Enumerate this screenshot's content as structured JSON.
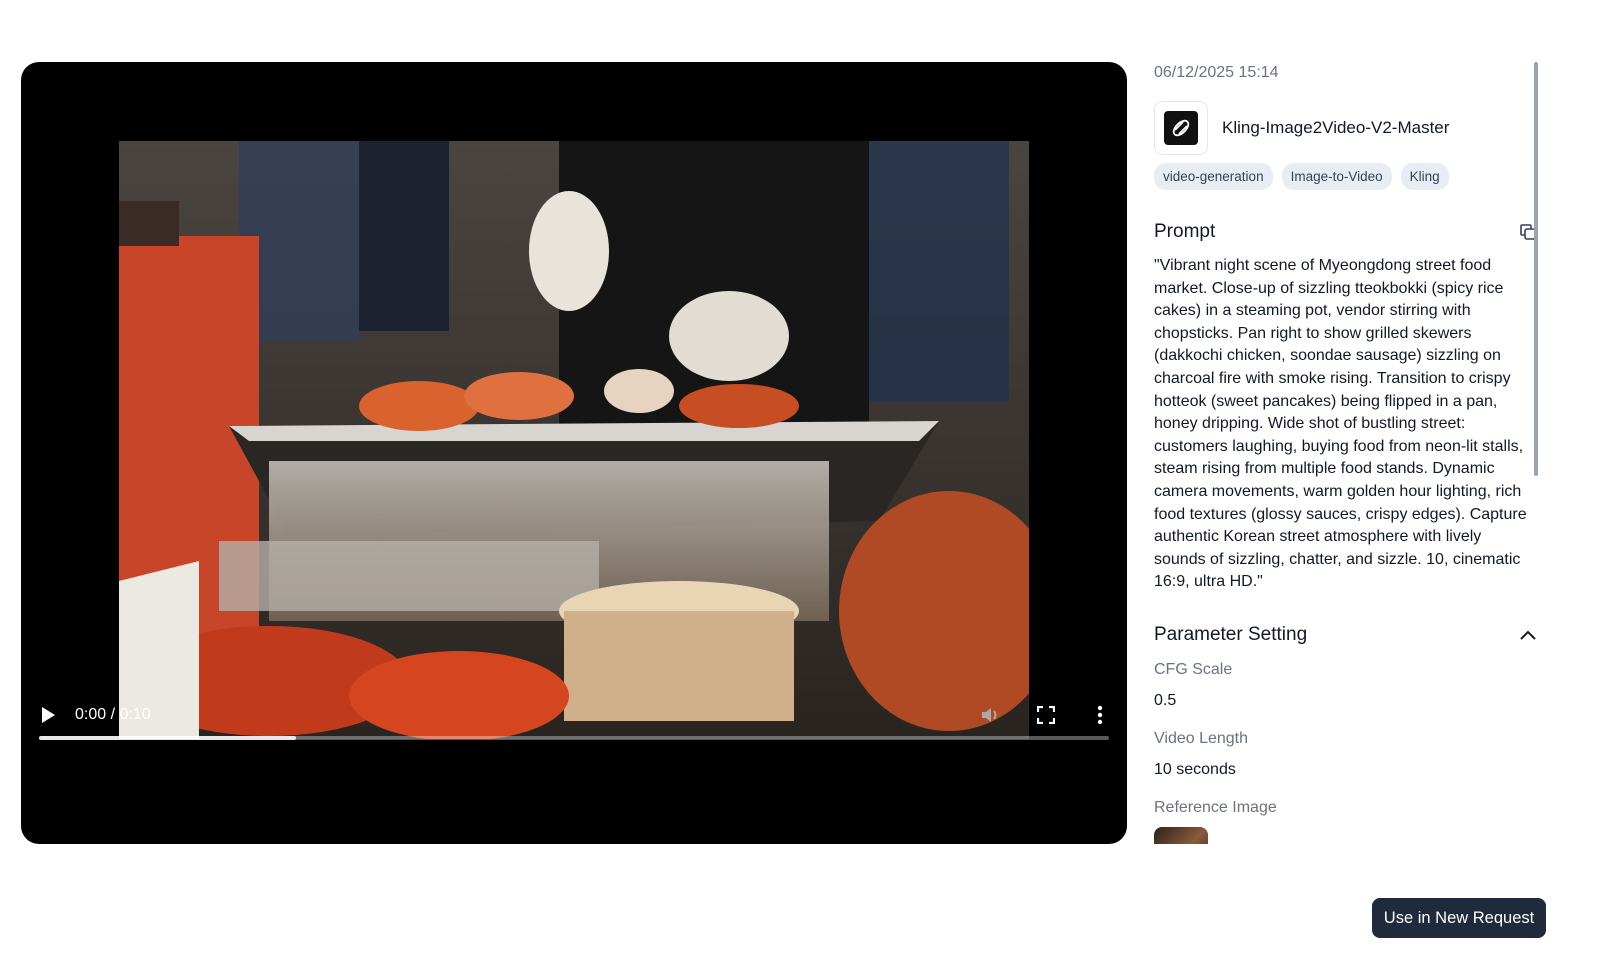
{
  "player": {
    "time_display": "0:00 / 0:10",
    "progress_fraction": 0.24,
    "icons": [
      "play-icon",
      "volume-icon",
      "fullscreen-icon",
      "more-options-icon"
    ]
  },
  "details": {
    "timestamp": "06/12/2025 15:14",
    "model_name": "Kling-Image2Video-V2-Master",
    "tags": [
      "video-generation",
      "Image-to-Video",
      "Kling"
    ],
    "prompt_title": "Prompt",
    "prompt_text": "\"Vibrant night scene of Myeongdong street food market. Close-up of sizzling tteokbokki (spicy rice cakes) in a steaming pot, vendor stirring with chopsticks. Pan right to show grilled skewers (dakkochi chicken, soondae sausage) sizzling on charcoal fire with smoke rising. Transition to crispy hotteok (sweet pancakes) being flipped in a pan, honey dripping. Wide shot of bustling street: customers laughing, buying food from neon-lit stalls, steam rising from multiple food stands. Dynamic camera movements, warm golden hour lighting, rich food textures (glossy sauces, crispy edges). Capture authentic Korean street atmosphere with lively sounds of sizzling, chatter, and sizzle. 10, cinematic 16:9, ultra HD.\"",
    "parameters_title": "Parameter Setting",
    "parameters": [
      {
        "label": "CFG Scale",
        "value": "0.5"
      },
      {
        "label": "Video Length",
        "value": "10 seconds"
      }
    ],
    "reference_image_label": "Reference Image"
  },
  "actions": {
    "use_in_new_request": "Use in New Request"
  }
}
